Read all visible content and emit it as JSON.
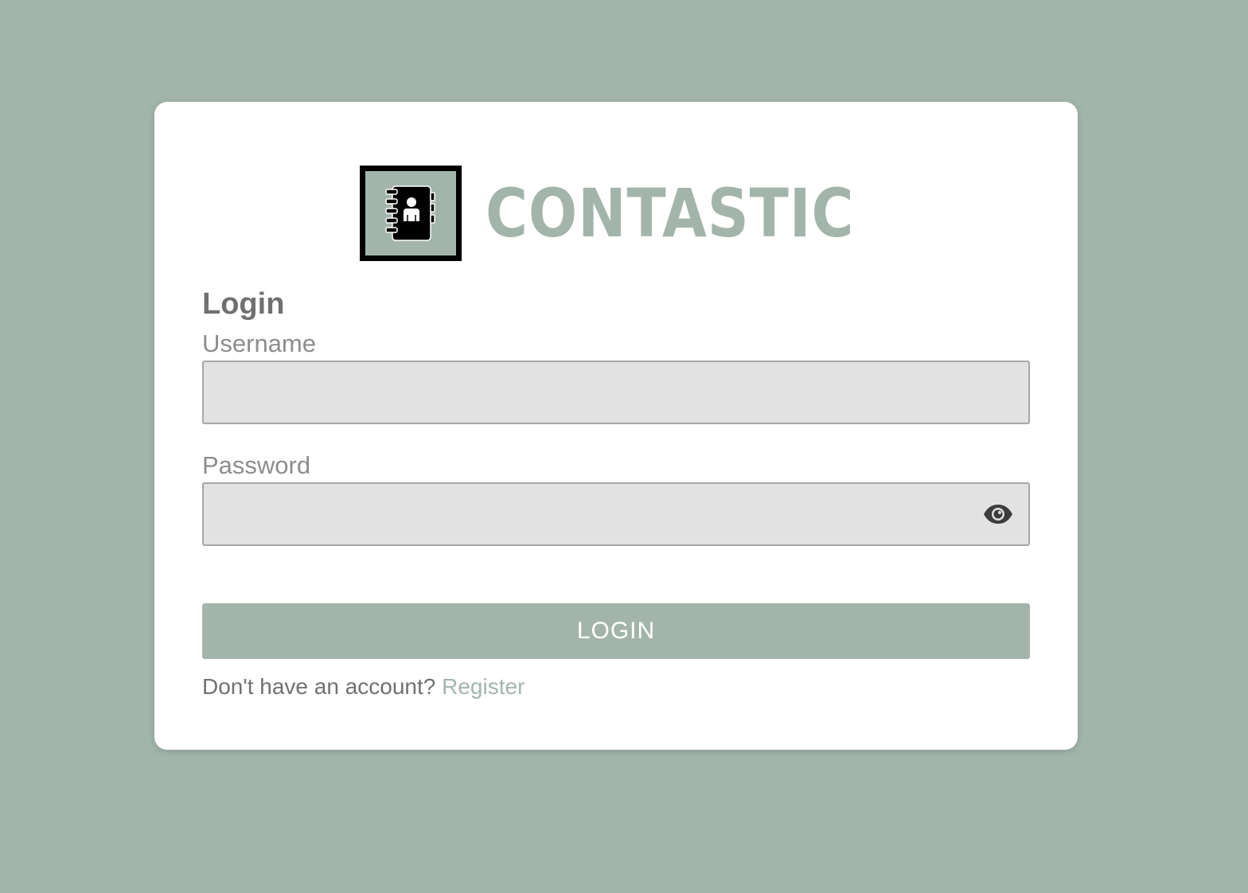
{
  "brand": {
    "name": "CONTASTIC",
    "logo_icon": "address-book-icon"
  },
  "login": {
    "title": "Login",
    "username": {
      "label": "Username",
      "value": "",
      "placeholder": ""
    },
    "password": {
      "label": "Password",
      "value": "",
      "placeholder": "",
      "toggle_icon": "eye-icon"
    },
    "submit_label": "LOGIN",
    "register_prompt": "Don't have an account?",
    "register_link": "Register"
  },
  "colors": {
    "background": "#a3b5ab",
    "card": "#ffffff",
    "accent": "#a3b5ab",
    "input_bg": "#e2e2e2",
    "text_muted": "#707070"
  }
}
